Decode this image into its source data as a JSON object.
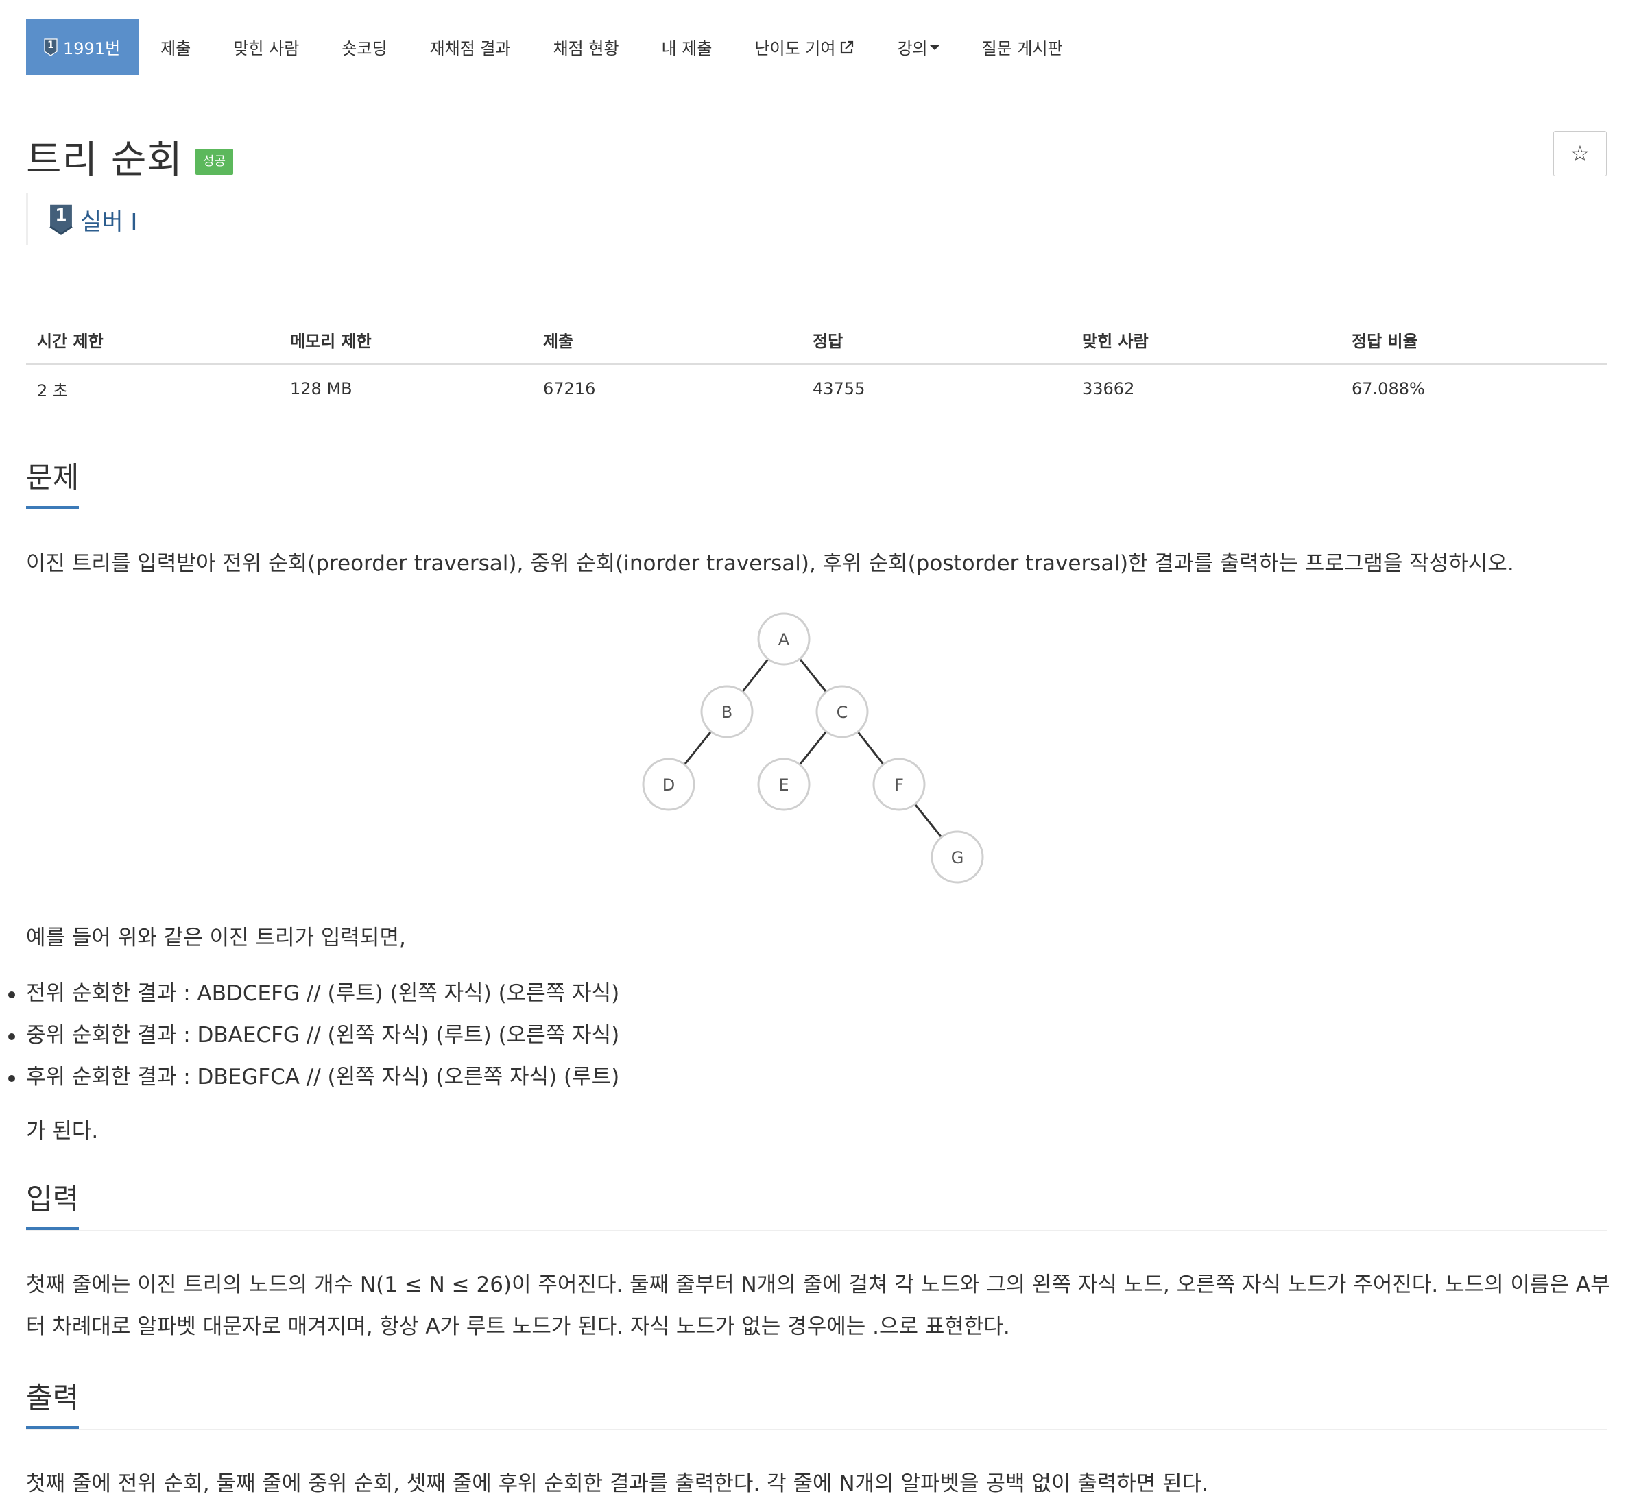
{
  "nav": {
    "items": [
      {
        "label": "1991번",
        "active": true
      },
      {
        "label": "제출"
      },
      {
        "label": "맞힌 사람"
      },
      {
        "label": "숏코딩"
      },
      {
        "label": "재채점 결과"
      },
      {
        "label": "채점 현황"
      },
      {
        "label": "내 제출"
      },
      {
        "label": "난이도 기여"
      },
      {
        "label": "강의"
      },
      {
        "label": "질문 게시판"
      }
    ]
  },
  "problem": {
    "title": "트리 순회",
    "status_badge": "성공",
    "star": "☆",
    "tier_number": "1",
    "tier": "실버 I"
  },
  "info_table": {
    "headers": [
      "시간 제한",
      "메모리 제한",
      "제출",
      "정답",
      "맞힌 사람",
      "정답 비율"
    ],
    "values": [
      "2 초",
      "128 MB",
      "67216",
      "43755",
      "33662",
      "67.088%"
    ]
  },
  "sections": {
    "problem": {
      "title": "문제",
      "intro": "이진 트리를 입력받아 전위 순회(preorder traversal), 중위 순회(inorder traversal), 후위 순회(postorder traversal)한 결과를 출력하는 프로그램을 작성하시오.",
      "example_lead": "예를 들어 위와 같은 이진 트리가 입력되면,",
      "bullets": [
        "전위 순회한 결과 : ABDCEFG // (루트) (왼쪽 자식) (오른쪽 자식)",
        "중위 순회한 결과 : DBAECFG // (왼쪽 자식) (루트) (오른쪽 자식)",
        "후위 순회한 결과 : DBEGFCA // (왼쪽 자식) (오른쪽 자식) (루트)"
      ],
      "closing": "가 된다."
    },
    "input": {
      "title": "입력",
      "text": "첫째 줄에는 이진 트리의 노드의 개수 N(1 ≤ N ≤ 26)이 주어진다. 둘째 줄부터 N개의 줄에 걸쳐 각 노드와 그의 왼쪽 자식 노드, 오른쪽 자식 노드가 주어진다. 노드의 이름은 A부터 차례대로 알파벳 대문자로 매겨지며, 항상 A가 루트 노드가 된다. 자식 노드가 없는 경우에는 .으로 표현한다."
    },
    "output": {
      "title": "출력",
      "text": "첫째 줄에 전위 순회, 둘째 줄에 중위 순회, 셋째 줄에 후위 순회한 결과를 출력한다. 각 줄에 N개의 알파벳을 공백 없이 출력하면 된다."
    }
  },
  "tree": {
    "nodes": [
      "A",
      "B",
      "C",
      "D",
      "E",
      "F",
      "G"
    ],
    "edges": [
      [
        "A",
        "B"
      ],
      [
        "A",
        "C"
      ],
      [
        "B",
        "D"
      ],
      [
        "C",
        "E"
      ],
      [
        "C",
        "F"
      ],
      [
        "F",
        "G"
      ]
    ]
  },
  "colors": {
    "nav_active": "#5a8fca",
    "badge_success": "#5cb85c",
    "tier_text": "#2c5d8e",
    "section_underline": "#3c7ab8"
  }
}
